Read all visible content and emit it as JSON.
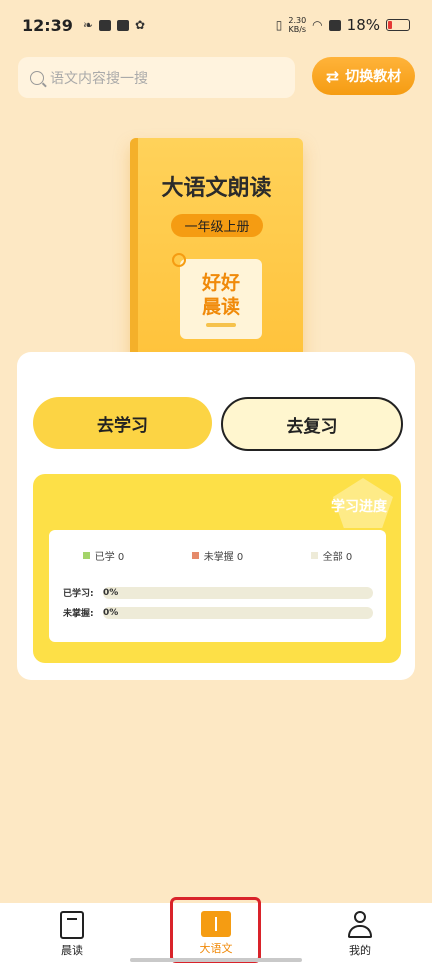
{
  "status_bar": {
    "time": "12:39",
    "net_speed_value": "2.30",
    "net_speed_unit": "KB/s",
    "battery_text": "18%"
  },
  "header": {
    "search_placeholder": "语文内容搜一搜",
    "switch_button_label": "切换教材"
  },
  "book": {
    "title": "大语文朗读",
    "grade": "一年级上册",
    "card_line1": "好好",
    "card_line2": "晨读"
  },
  "actions": {
    "learn_label": "去学习",
    "review_label": "去复习"
  },
  "progress": {
    "title": "学习进度",
    "legend": [
      {
        "label": "已学 0",
        "color": "#a4d46a"
      },
      {
        "label": "未掌握 0",
        "color": "#e58a6a"
      },
      {
        "label": "全部 0",
        "color": "#eeebd8"
      }
    ],
    "rows": [
      {
        "label": "已学习:",
        "value": "0%",
        "fraction": 0
      },
      {
        "label": "未掌握:",
        "value": "0%",
        "fraction": 0
      }
    ]
  },
  "bottom_nav": {
    "items": [
      {
        "label": "晨读",
        "icon": "bookmark-icon"
      },
      {
        "label": "大语文",
        "icon": "book-open-icon",
        "active": true
      },
      {
        "label": "我的",
        "icon": "user-icon"
      }
    ]
  },
  "colors": {
    "accent": "#f59c12",
    "background": "#fde8c4",
    "progress_panel": "#fde047",
    "highlight": "#d9232a"
  }
}
